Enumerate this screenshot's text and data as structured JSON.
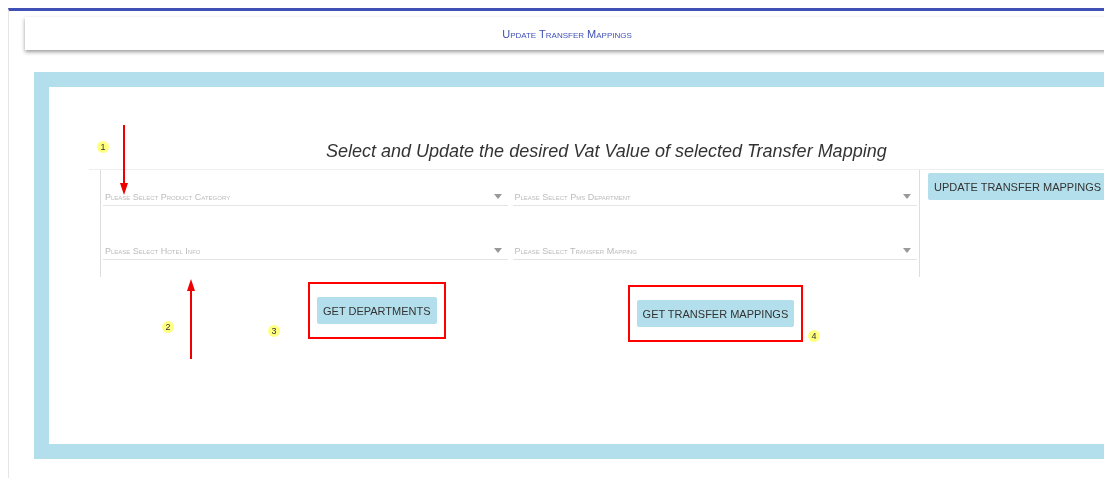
{
  "header": {
    "title": "Update Transfer Mappings"
  },
  "form": {
    "heading": "Select and Update the desired Vat Value of selected Transfer Mapping",
    "selects": [
      {
        "placeholder": "Please Select Product Category"
      },
      {
        "placeholder": "Please Select Pms Department"
      },
      {
        "placeholder": "Please Select Hotel Info"
      },
      {
        "placeholder": "Please Select Transfer Mapping"
      }
    ],
    "update_button": "UPDATE TRANSFER MAPPINGS",
    "buttons": [
      {
        "label": "GET DEPARTMENTS",
        "highlighted": true,
        "marker": "3"
      },
      {
        "label": "GET TRANSFER MAPPINGS",
        "highlighted": true,
        "marker": "4"
      }
    ]
  },
  "markers": [
    {
      "label": "1"
    },
    {
      "label": "2"
    }
  ]
}
